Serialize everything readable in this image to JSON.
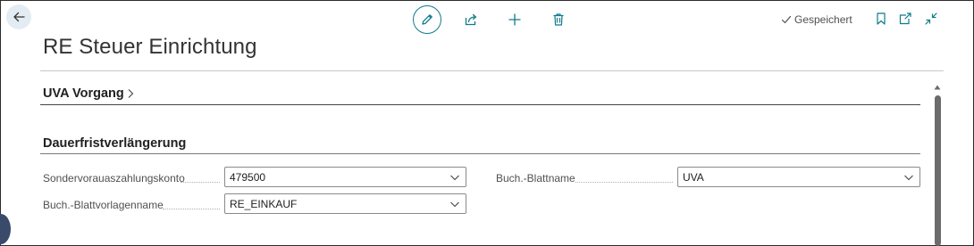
{
  "toolbar": {
    "back_icon": "arrow-left-icon",
    "edit_icon": "pencil-icon",
    "share_icon": "share-icon",
    "add_icon": "plus-icon",
    "delete_icon": "trash-icon",
    "saved_status": "Gespeichert",
    "bookmark_icon": "bookmark-icon",
    "open_new_icon": "open-in-new-window-icon",
    "collapse_icon": "collapse-icon"
  },
  "page": {
    "title": "RE Steuer Einrichtung"
  },
  "sections": {
    "uva": {
      "title": "UVA Vorgang"
    },
    "dauer": {
      "title": "Dauerfristverlängerung"
    }
  },
  "fields": {
    "sondervorauszahlungskonto": {
      "label": "Sondervorauaszahlungskonto",
      "value": "479500"
    },
    "blattvorlagenname": {
      "label": "Buch.-Blattvorlagenname",
      "value": "RE_EINKAUF"
    },
    "blattname": {
      "label": "Buch.-Blattname",
      "value": "UVA"
    }
  },
  "colors": {
    "accent": "#0f7b8c",
    "back_button_bg": "#e3ecf3"
  }
}
